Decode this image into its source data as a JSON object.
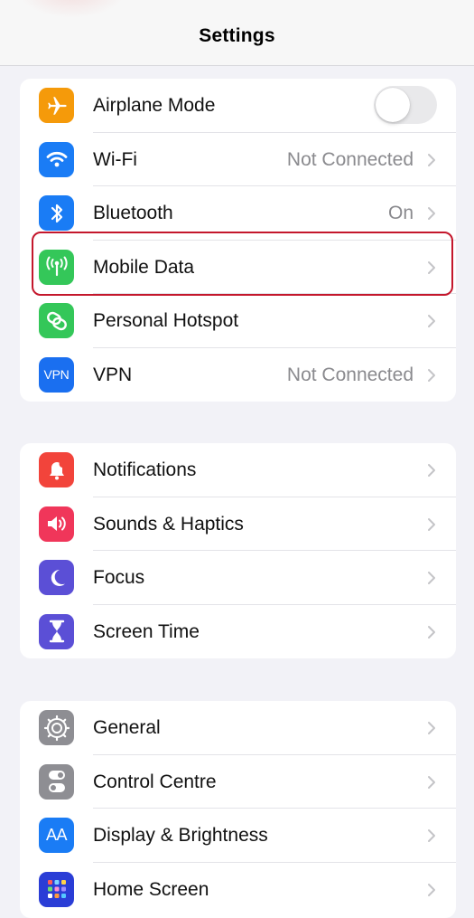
{
  "header": {
    "title": "Settings"
  },
  "colors": {
    "highlight": "#c4172c",
    "background": "#f2f2f7",
    "secondary_text": "#8a8a8e"
  },
  "groups": [
    {
      "items": [
        {
          "label": "Airplane Mode",
          "icon": "airplane-icon",
          "icon_color": "#f59a0a",
          "control": "toggle",
          "toggle_on": false
        },
        {
          "label": "Wi-Fi",
          "icon": "wifi-icon",
          "icon_color": "#1a7cf5",
          "value": "Not Connected"
        },
        {
          "label": "Bluetooth",
          "icon": "bluetooth-icon",
          "icon_color": "#1a7cf5",
          "value": "On"
        },
        {
          "label": "Mobile Data",
          "icon": "antenna-icon",
          "icon_color": "#34c759",
          "highlighted": true
        },
        {
          "label": "Personal Hotspot",
          "icon": "hotspot-icon",
          "icon_color": "#34c759"
        },
        {
          "label": "VPN",
          "icon": "vpn-icon",
          "icon_text": "VPN",
          "icon_color": "#1a6ff0",
          "value": "Not Connected"
        }
      ]
    },
    {
      "items": [
        {
          "label": "Notifications",
          "icon": "bell-icon",
          "icon_color": "#f2443b"
        },
        {
          "label": "Sounds & Haptics",
          "icon": "speaker-icon",
          "icon_color": "#f0365a"
        },
        {
          "label": "Focus",
          "icon": "moon-icon",
          "icon_color": "#5b4fd6"
        },
        {
          "label": "Screen Time",
          "icon": "hourglass-icon",
          "icon_color": "#5b4fd6"
        }
      ]
    },
    {
      "items": [
        {
          "label": "General",
          "icon": "gear-icon",
          "icon_color": "#8e8e93"
        },
        {
          "label": "Control Centre",
          "icon": "switches-icon",
          "icon_color": "#8e8e93"
        },
        {
          "label": "Display & Brightness",
          "icon": "text-size-icon",
          "icon_text": "AA",
          "icon_color": "#1a7cf5"
        },
        {
          "label": "Home Screen",
          "icon": "home-grid-icon",
          "icon_color": "#2a3dd6"
        }
      ]
    }
  ]
}
